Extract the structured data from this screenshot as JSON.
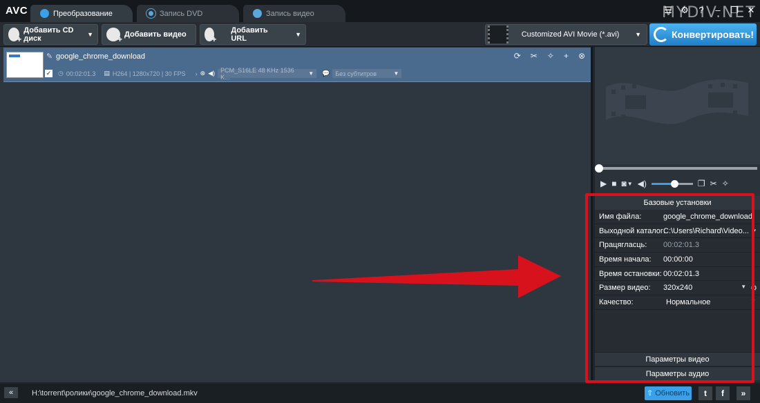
{
  "app": {
    "logo": "AVC",
    "watermark": "MYDIV.NET"
  },
  "tabs": [
    {
      "label": "Преобразование",
      "active": true
    },
    {
      "label": "Запись DVD",
      "active": false
    },
    {
      "label": "Запись видео",
      "active": false
    }
  ],
  "toolbar": {
    "add_cd": "Добавить CD диск",
    "add_video": "Добавить видео",
    "add_url": "Добавить URL",
    "profile": "Customized AVI Movie (*.avi)",
    "convert": "Конвертировать!"
  },
  "file_item": {
    "name": "google_chrome_download",
    "duration": "00:02:01.3",
    "video_info": "H264 | 1280x720 | 30 FPS",
    "audio_track": "PCM_S16LE 48 KHz 1536 K...",
    "subtitles": "Без субтитров"
  },
  "player": {
    "volume_level": 0.55
  },
  "settings": {
    "title": "Базовые установки",
    "rows": [
      {
        "key": "Имя файла:",
        "value": "google_chrome_download"
      },
      {
        "key": "Выходной каталог:",
        "value": "C:\\Users\\Richard\\Video..."
      },
      {
        "key": "Працягласць:",
        "value": "00:02:01.3"
      },
      {
        "key": "Время начала:",
        "value": "00:00:00"
      },
      {
        "key": "Время остановки:",
        "value": "00:02:01.3"
      },
      {
        "key": "Размер видео:",
        "value": "320x240"
      },
      {
        "key": "Качество:",
        "value": "Нормальное"
      }
    ],
    "video_params": "Параметры видео",
    "audio_params": "Параметры аудио"
  },
  "status": {
    "path": "H:\\torrent\\ролики\\google_chrome_download.mkv",
    "update": "Обновить"
  },
  "colors": {
    "accent": "#3aa0e8",
    "selection": "#4a6a8e",
    "annotation": "#d8121d"
  }
}
